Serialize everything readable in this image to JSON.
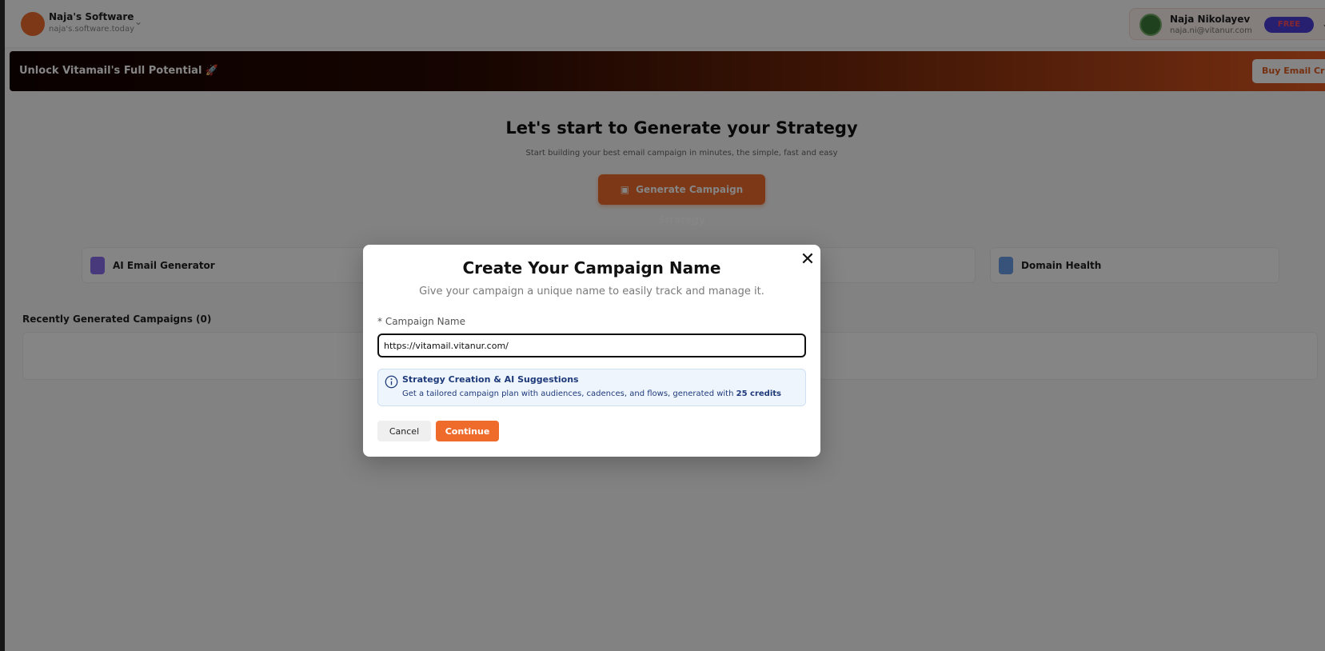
{
  "topbar": {
    "workspace_name": "Naja's Software",
    "workspace_sub": "naja's.software.today",
    "profile_name": "Naja Nikolayev",
    "profile_email": "naja.ni@vitanur.com",
    "plan_badge": "FREE"
  },
  "banner": {
    "text": "Unlock Vitamail's Full Potential 🚀",
    "button_label": "Buy Email Credits"
  },
  "hero": {
    "title": "Let's start to Generate your Strategy",
    "subtitle": "Start building your best email campaign in minutes, the simple, fast and easy",
    "button_label": "Generate Campaign Strategy"
  },
  "tools": [
    {
      "label": "AI Email Generator",
      "icon": "document-icon",
      "color": "#8a6df0"
    },
    {
      "label": "Domain Health",
      "icon": "clipboard-icon",
      "color": "#6aa0e8"
    }
  ],
  "recent": {
    "title": "Recently Generated Campaigns (0)"
  },
  "modal": {
    "title": "Create Your Campaign Name",
    "subtitle": "Give your campaign a unique name to easily track and manage it.",
    "field_label": "Campaign Name",
    "field_required_mark": "*",
    "field_value": "https://vitamail.vitanur.com/",
    "info_title": "Strategy Creation & AI Suggestions",
    "info_desc": "Get a tailored campaign plan with audiences, cadences, and flows, generated with",
    "info_credits": "25 credits",
    "cancel_label": "Cancel",
    "continue_label": "Continue",
    "close_icon": "close-icon"
  },
  "colors": {
    "accent": "#ef6b2c",
    "info_bg": "#eef5fd",
    "info_text": "#1f3a7a"
  }
}
